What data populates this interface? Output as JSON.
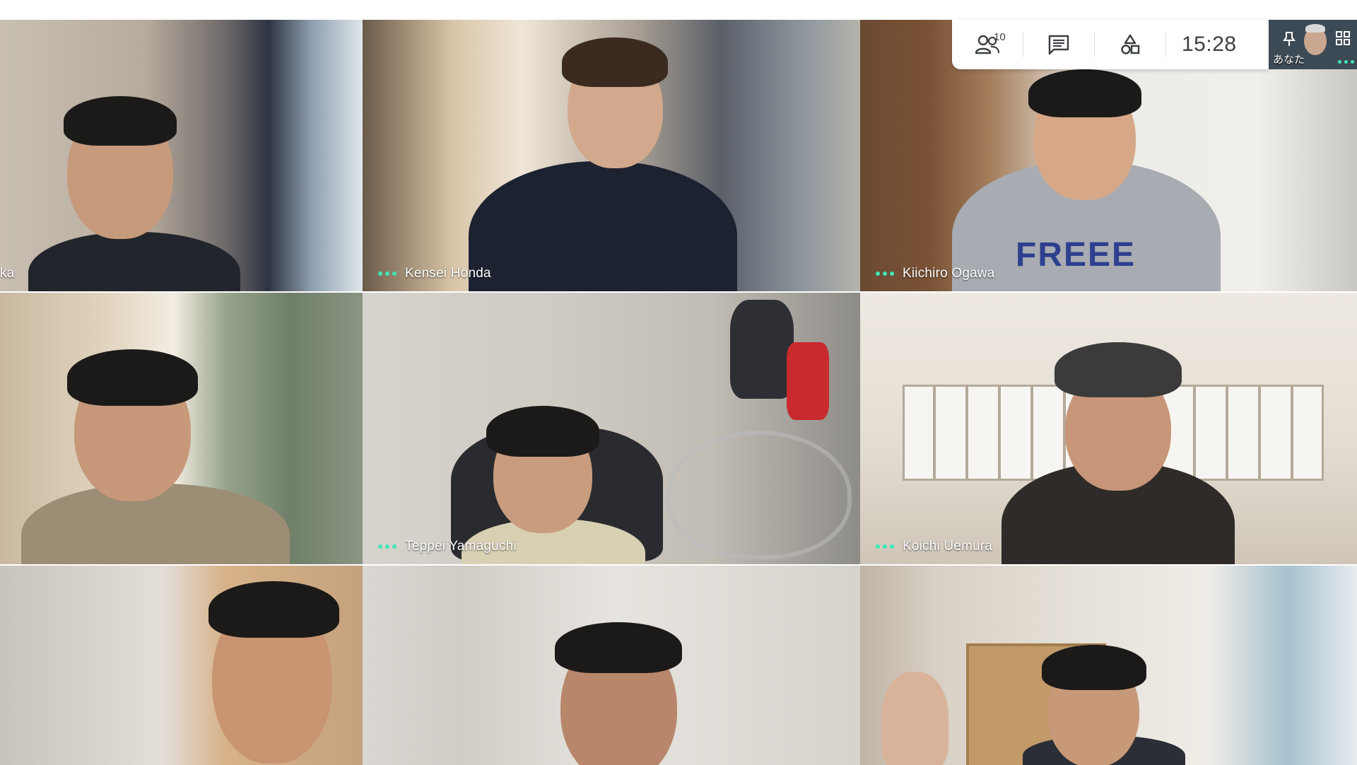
{
  "toolbar": {
    "participants_icon": "people-icon",
    "participants_count": "10",
    "chat_icon": "chat-icon",
    "activities_icon": "shapes-icon",
    "clock": "15:28"
  },
  "self_view": {
    "label": "あなた",
    "pin_icon": "pin-icon",
    "layout_icon": "grid-layout-icon"
  },
  "participants": [
    {
      "name": "ka"
    },
    {
      "name": "Kensei Honda"
    },
    {
      "name": "Kiichiro Ogawa",
      "shirt_text": "FREEE"
    },
    {
      "name": ""
    },
    {
      "name": "Teppei Yamaguchi"
    },
    {
      "name": "Koichi Uemura"
    },
    {
      "name": ""
    },
    {
      "name": ""
    },
    {
      "name": ""
    }
  ],
  "colors": {
    "speaking_dots": "#3ee6b4",
    "toolbar_bg": "#ffffff",
    "icon": "#3c4043"
  }
}
